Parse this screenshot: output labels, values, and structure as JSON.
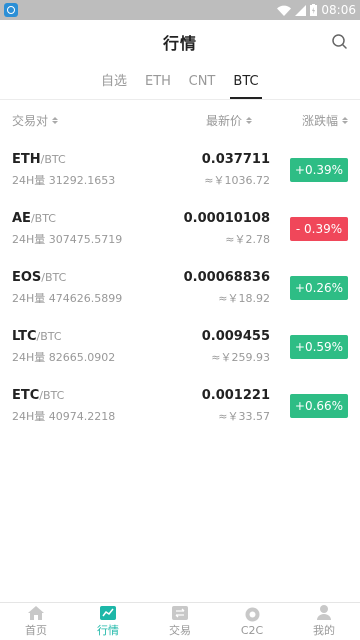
{
  "status_bar": {
    "time": "08:06"
  },
  "header": {
    "title": "行情"
  },
  "tabs": [
    {
      "label": "自选",
      "active": false
    },
    {
      "label": "ETH",
      "active": false
    },
    {
      "label": "CNT",
      "active": false
    },
    {
      "label": "BTC",
      "active": true
    }
  ],
  "columns": {
    "pair": "交易对",
    "price": "最新价",
    "change": "涨跌幅"
  },
  "rows": [
    {
      "symbol": "ETH",
      "quote": "/BTC",
      "volume": "24H量 31292.1653",
      "price": "0.037711",
      "cny": "≈￥1036.72",
      "change": "+0.39%",
      "direction": "up"
    },
    {
      "symbol": "AE",
      "quote": "/BTC",
      "volume": "24H量 307475.5719",
      "price": "0.00010108",
      "cny": "≈￥2.78",
      "change": "- 0.39%",
      "direction": "down"
    },
    {
      "symbol": "EOS",
      "quote": "/BTC",
      "volume": "24H量 474626.5899",
      "price": "0.00068836",
      "cny": "≈￥18.92",
      "change": "+0.26%",
      "direction": "up"
    },
    {
      "symbol": "LTC",
      "quote": "/BTC",
      "volume": "24H量 82665.0902",
      "price": "0.009455",
      "cny": "≈￥259.93",
      "change": "+0.59%",
      "direction": "up"
    },
    {
      "symbol": "ETC",
      "quote": "/BTC",
      "volume": "24H量 40974.2218",
      "price": "0.001221",
      "cny": "≈￥33.57",
      "change": "+0.66%",
      "direction": "up"
    }
  ],
  "bottom_nav": [
    {
      "label": "首页",
      "icon": "home-icon",
      "active": false
    },
    {
      "label": "行情",
      "icon": "chart-icon",
      "active": true
    },
    {
      "label": "交易",
      "icon": "trade-icon",
      "active": false
    },
    {
      "label": "C2C",
      "icon": "c2c-icon",
      "active": false
    },
    {
      "label": "我的",
      "icon": "user-icon",
      "active": false
    }
  ],
  "colors": {
    "up": "#2ebd85",
    "down": "#f0475a",
    "accent": "#1db7a8"
  }
}
